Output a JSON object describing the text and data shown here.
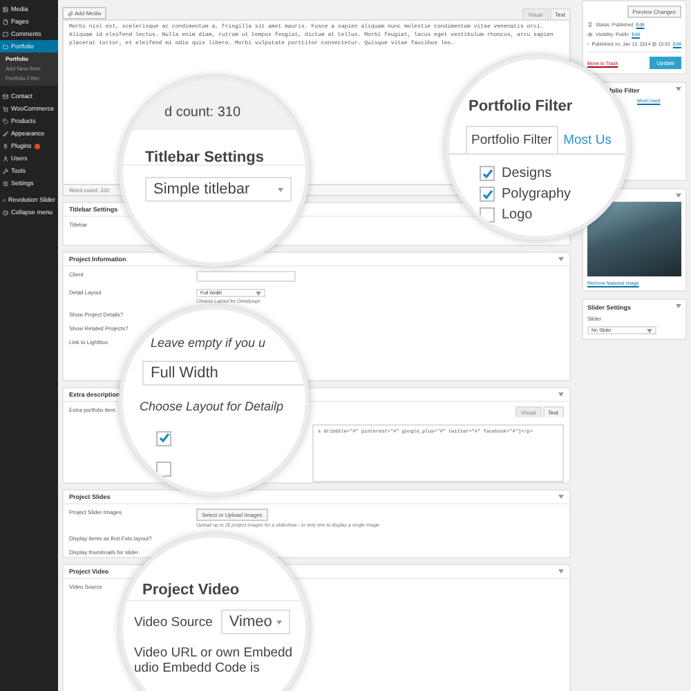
{
  "sidebar": {
    "items": [
      {
        "label": "Media",
        "selected": false
      },
      {
        "label": "Pages",
        "selected": false
      },
      {
        "label": "Comments",
        "selected": false
      },
      {
        "label": "Portfolio",
        "selected": true,
        "children": [
          {
            "label": "Portfolio",
            "selected": true
          },
          {
            "label": "Add New Item",
            "selected": false
          },
          {
            "label": "Portfolio Filter",
            "selected": false
          }
        ]
      },
      {
        "label": "Contact",
        "selected": false
      },
      {
        "label": "WooCommerce",
        "selected": false
      },
      {
        "label": "Products",
        "selected": false
      },
      {
        "label": "Appearance",
        "selected": false
      },
      {
        "label": "Plugins",
        "selected": false,
        "badge": true
      },
      {
        "label": "Users",
        "selected": false
      },
      {
        "label": "Tools",
        "selected": false
      },
      {
        "label": "Settings",
        "selected": false
      },
      {
        "label": "Revolution Slider",
        "selected": false
      },
      {
        "label": "Collapse menu",
        "selected": false
      }
    ]
  },
  "editor": {
    "add_media": "Add Media",
    "tabs": [
      {
        "label": "Visual",
        "selected": false
      },
      {
        "label": "Text",
        "selected": true
      }
    ],
    "content": "Morbi nisl est, scelerisque ac condimentum a, fringilla sit amet mauris. Fusce a sapien aliquam nunc molestie condimentum vitae venenatis orci. Aliquam id eleifend lectus. Nulla enim diam, rutrum ut tempus feugiat, dictum at tellus. Morbi feugiat, lacus eget vestibulum rhoncus, arcu sapien placerat tortor, et eleifend mi odio quis libero. Morbi vulputate porttitor consectetur. Quisque vitae faucibus leo.",
    "word_count": "Word count: 310"
  },
  "titlebar_panel": {
    "title": "Titlebar Settings",
    "label": "Titlebar"
  },
  "project_info": {
    "title": "Project Information",
    "fields": [
      {
        "label": "Client",
        "kind": "text"
      },
      {
        "label": "Detail Layout",
        "kind": "select",
        "value": "Full Width",
        "hint": "Choose Layout for Detailpage"
      },
      {
        "label": "Show Project Details?",
        "kind": "label"
      },
      {
        "label": "Show Related Projects?",
        "kind": "label"
      },
      {
        "label": "Link to Lightbox",
        "kind": "label"
      }
    ]
  },
  "extra_description": {
    "title": "Extra description",
    "label": "Extra portfolio item",
    "tabs": [
      {
        "label": "Visual",
        "selected": false
      },
      {
        "label": "Text",
        "selected": true
      }
    ],
    "content": "s dribbble=\"#\" pinterest=\"#\" google_plus=\"#\" twitter=\"#\" facebook=\"#\"]</p>"
  },
  "project_slides": {
    "title": "Project Slides",
    "label": "Project Slider Images",
    "button": "Select or Upload Images",
    "hint": "Upload up to 20 project images for a slideshow - or only one to display a single image",
    "labels": [
      "Display items as first Foto layout?",
      "Display thumbnails for slider"
    ]
  },
  "project_video": {
    "title": "Project Video",
    "label": "Video Source"
  },
  "publish": {
    "preview": "Preview Changes",
    "rows": [
      {
        "label": "Status: Published",
        "link": "Edit"
      },
      {
        "label": "Visibility: Public",
        "link": "Edit"
      },
      {
        "label": "Published on: Jan 13, 2014 @ 10:53",
        "link": "Edit"
      }
    ],
    "trash": "Move to Trash",
    "update": "Update"
  },
  "filter_box": {
    "title": "folio Filter",
    "tab": "Most Used"
  },
  "featured_image": {
    "link": "Remove featured image"
  },
  "slider_settings": {
    "title": "Slider Settings",
    "label": "Slider",
    "value": "No Slider"
  },
  "magnifiers": [
    {
      "kind": "titlebar",
      "top_text": "d count: 310",
      "title": "Titlebar Settings",
      "select": "Simple titlebar"
    },
    {
      "kind": "filter",
      "title": "Portfolio Filter",
      "tabs": [
        {
          "label": "Portfolio Filter",
          "selected": true
        },
        {
          "label": "Most Us",
          "selected": false
        }
      ],
      "options": [
        {
          "label": "Designs",
          "checked": true
        },
        {
          "label": "Polygraphy",
          "checked": true
        },
        {
          "label": "Logo",
          "checked": false
        }
      ]
    },
    {
      "kind": "layout",
      "hint_top": "Leave empty if you u",
      "select": "Full Width",
      "hint": "Choose Layout for Detailp",
      "checkboxes": [
        {
          "checked": true
        },
        {
          "checked": false
        }
      ]
    },
    {
      "kind": "video",
      "title": "Project Video",
      "label": "Video Source",
      "select": "Vimeo",
      "lines": [
        "Video URL or own Embedd",
        "udio Embedd Code is"
      ]
    }
  ]
}
